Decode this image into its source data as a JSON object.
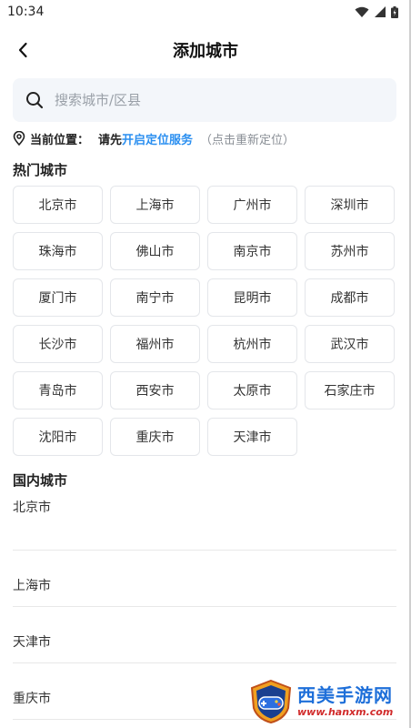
{
  "status_bar": {
    "time": "10:34"
  },
  "header": {
    "title": "添加城市"
  },
  "search": {
    "placeholder": "搜索城市/区县"
  },
  "location": {
    "label": "当前位置：",
    "prefix": "请先",
    "link_text": "开启定位服务",
    "hint": "（点击重新定位）",
    "link_color": "#2b8ff0"
  },
  "hot_cities": {
    "title": "热门城市",
    "items": [
      "北京市",
      "上海市",
      "广州市",
      "深圳市",
      "珠海市",
      "佛山市",
      "南京市",
      "苏州市",
      "厦门市",
      "南宁市",
      "昆明市",
      "成都市",
      "长沙市",
      "福州市",
      "杭州市",
      "武汉市",
      "青岛市",
      "西安市",
      "太原市",
      "石家庄市",
      "沈阳市",
      "重庆市",
      "天津市"
    ]
  },
  "domestic_cities": {
    "title": "国内城市",
    "items": [
      "北京市",
      "上海市",
      "天津市",
      "重庆市"
    ]
  },
  "watermark": {
    "title": "西美手游网",
    "url": "www.hanxm.com"
  }
}
